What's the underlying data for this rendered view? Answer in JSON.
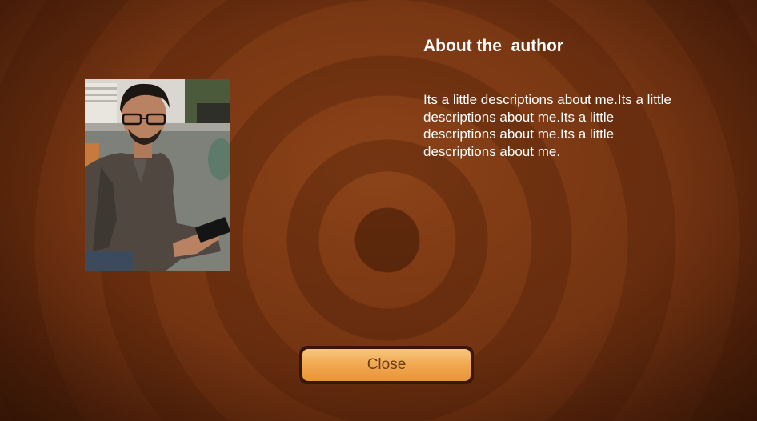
{
  "about": {
    "title": "About the  author",
    "description": "Its a little descriptions about me.Its a little descriptions about me.Its a little descriptions about me.Its a little descriptions about me."
  },
  "close_button": {
    "label": "Close"
  },
  "colors": {
    "background": "#7a3813",
    "button_fill": "#f1a84f",
    "button_text": "#6b3a1c",
    "text": "#ffffff"
  }
}
